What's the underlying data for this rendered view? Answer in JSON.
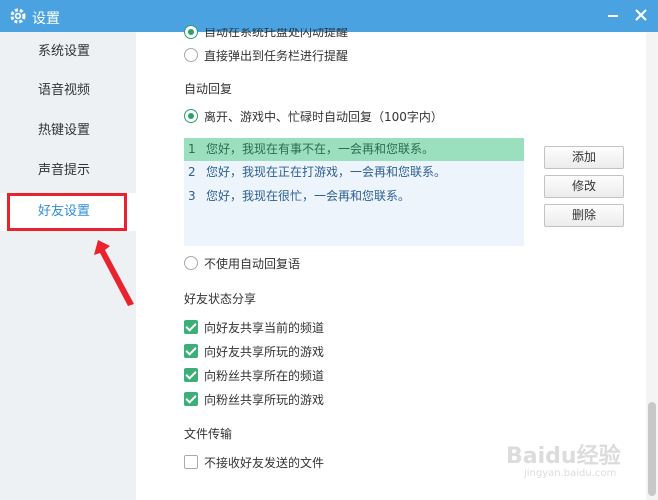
{
  "window": {
    "title": "设置"
  },
  "sidebar": {
    "items": [
      {
        "label": "系统设置"
      },
      {
        "label": "语音视频"
      },
      {
        "label": "热键设置"
      },
      {
        "label": "声音提示"
      },
      {
        "label": "好友设置",
        "active": true
      }
    ]
  },
  "message_reminder": {
    "option_top_partial": "自动在系统托盘处闪动提醒",
    "option_taskbar": "直接弹出到任务栏进行提醒"
  },
  "auto_reply": {
    "title": "自动回复",
    "option_enable": "离开、游戏中、忙碌时自动回复（100字内）",
    "replies": [
      {
        "num": "1",
        "text": "您好，我现在有事不在，一会再和您联系。",
        "selected": true
      },
      {
        "num": "2",
        "text": "您好，我现在正在打游戏，一会再和您联系。"
      },
      {
        "num": "3",
        "text": "您好，我现在很忙，一会再和您联系。"
      }
    ],
    "buttons": {
      "add": "添加",
      "edit": "修改",
      "delete": "删除"
    },
    "option_disable": "不使用自动回复语"
  },
  "friend_status_share": {
    "title": "好友状态分享",
    "items": [
      {
        "label": "向好友共享当前的频道",
        "checked": true
      },
      {
        "label": "向好友共享所玩的游戏",
        "checked": true
      },
      {
        "label": "向粉丝共享所在的频道",
        "checked": true
      },
      {
        "label": "向粉丝共享所玩的游戏",
        "checked": true
      }
    ]
  },
  "file_transfer": {
    "title": "文件传输",
    "option_reject": "不接收好友发送的文件"
  },
  "watermark": {
    "brand": "Baidu经验",
    "sub": "jingyan.baidu.com"
  },
  "colors": {
    "titlebar": "#4aa3e0",
    "accent_green": "#3cae77",
    "selected_row": "#9be0be",
    "annotation_red": "#e8232f"
  }
}
